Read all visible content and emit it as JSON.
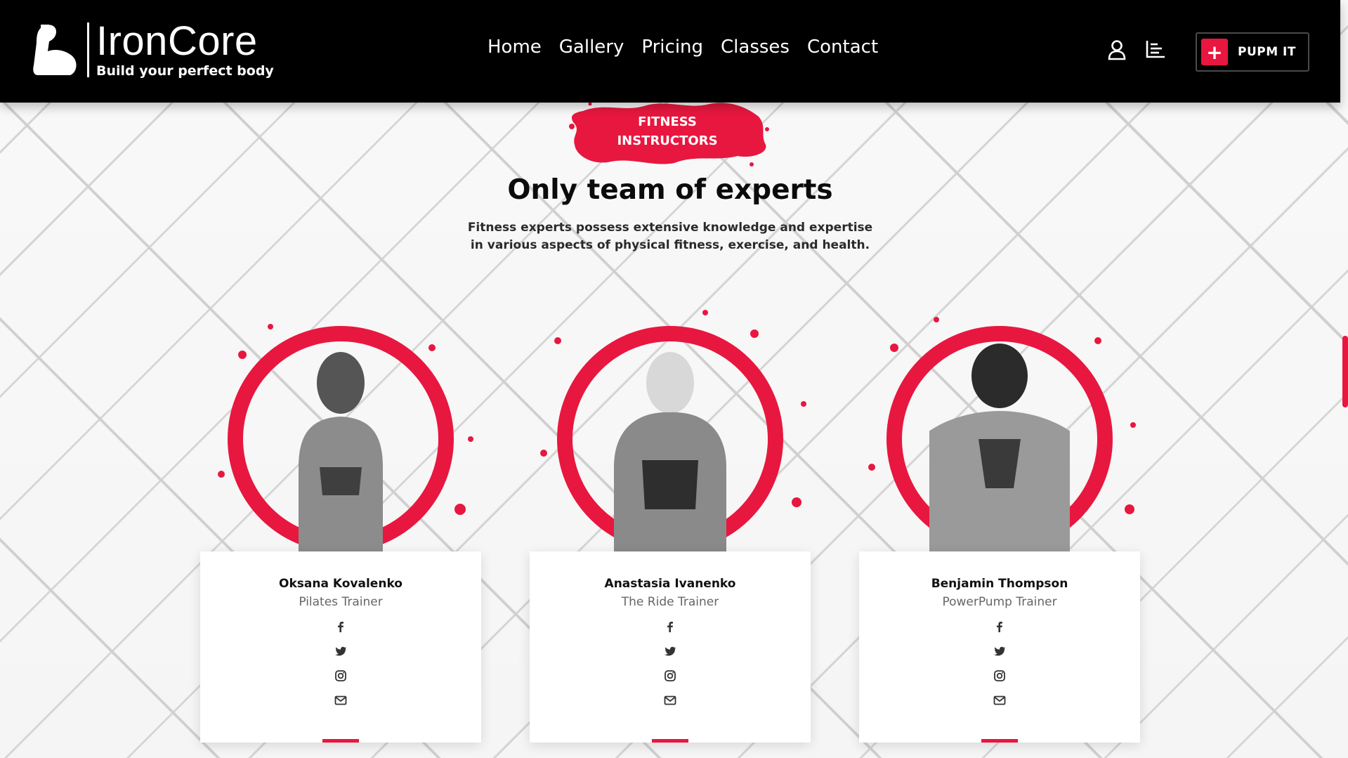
{
  "brand": {
    "name": "IronCore",
    "tagline": "Build your perfect body",
    "accent": "#e8173f"
  },
  "nav": [
    {
      "label": "Home"
    },
    {
      "label": "Gallery"
    },
    {
      "label": "Pricing"
    },
    {
      "label": "Classes"
    },
    {
      "label": "Contact"
    }
  ],
  "header_icons": [
    "user-icon",
    "list-chart-icon"
  ],
  "cta": {
    "label": "PUPM IT",
    "icon": "plus-icon"
  },
  "section": {
    "badge_line1": "FITNESS",
    "badge_line2": "INSTRUCTORS",
    "title": "Only team of experts",
    "subtitle": "Fitness experts possess extensive knowledge and expertise in various aspects of physical fitness, exercise, and health."
  },
  "trainers": [
    {
      "name": "Oksana Kovalenko",
      "role": "Pilates Trainer"
    },
    {
      "name": "Anastasia Ivanenko",
      "role": "The Ride Trainer"
    },
    {
      "name": "Benjamin Thompson",
      "role": "PowerPump Trainer"
    }
  ],
  "social_icons": [
    "facebook-icon",
    "twitter-icon",
    "instagram-icon",
    "mail-icon"
  ]
}
